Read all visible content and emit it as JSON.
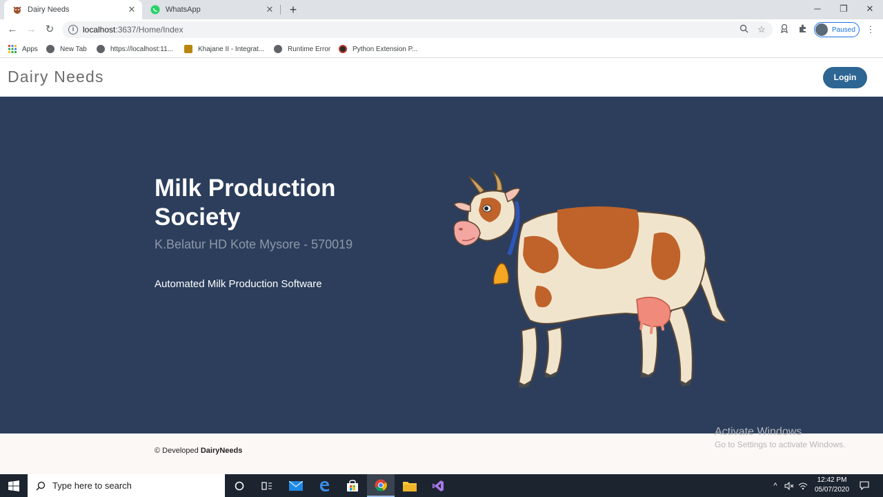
{
  "browser": {
    "tabs": [
      {
        "title": "Dairy Needs",
        "active": true
      },
      {
        "title": "WhatsApp",
        "active": false
      }
    ],
    "url_host": "localhost",
    "url_path": ":3637/Home/Index",
    "profile_status": "Paused",
    "bookmarks": [
      {
        "label": "Apps"
      },
      {
        "label": "New Tab"
      },
      {
        "label": "https://localhost:11..."
      },
      {
        "label": "Khajane II - Integrat..."
      },
      {
        "label": "Runtime Error"
      },
      {
        "label": "Python Extension P..."
      }
    ]
  },
  "page": {
    "brand": "Dairy Needs",
    "login_label": "Login",
    "hero_title": "Milk Production Society",
    "hero_subtitle": "K.Belatur HD Kote Mysore - 570019",
    "hero_tagline": "Automated Milk Production Software",
    "footer_prefix": "© Developed",
    "footer_brand": "DairyNeeds",
    "activate_title": "Activate Windows",
    "activate_sub": "Go to Settings to activate Windows."
  },
  "taskbar": {
    "search_placeholder": "Type here to search",
    "time": "12:42 PM",
    "date": "05/07/2020"
  },
  "colors": {
    "hero_bg": "#2c3e5c",
    "login_bg": "#2d6593",
    "footer_bg": "#fcf8f5"
  }
}
